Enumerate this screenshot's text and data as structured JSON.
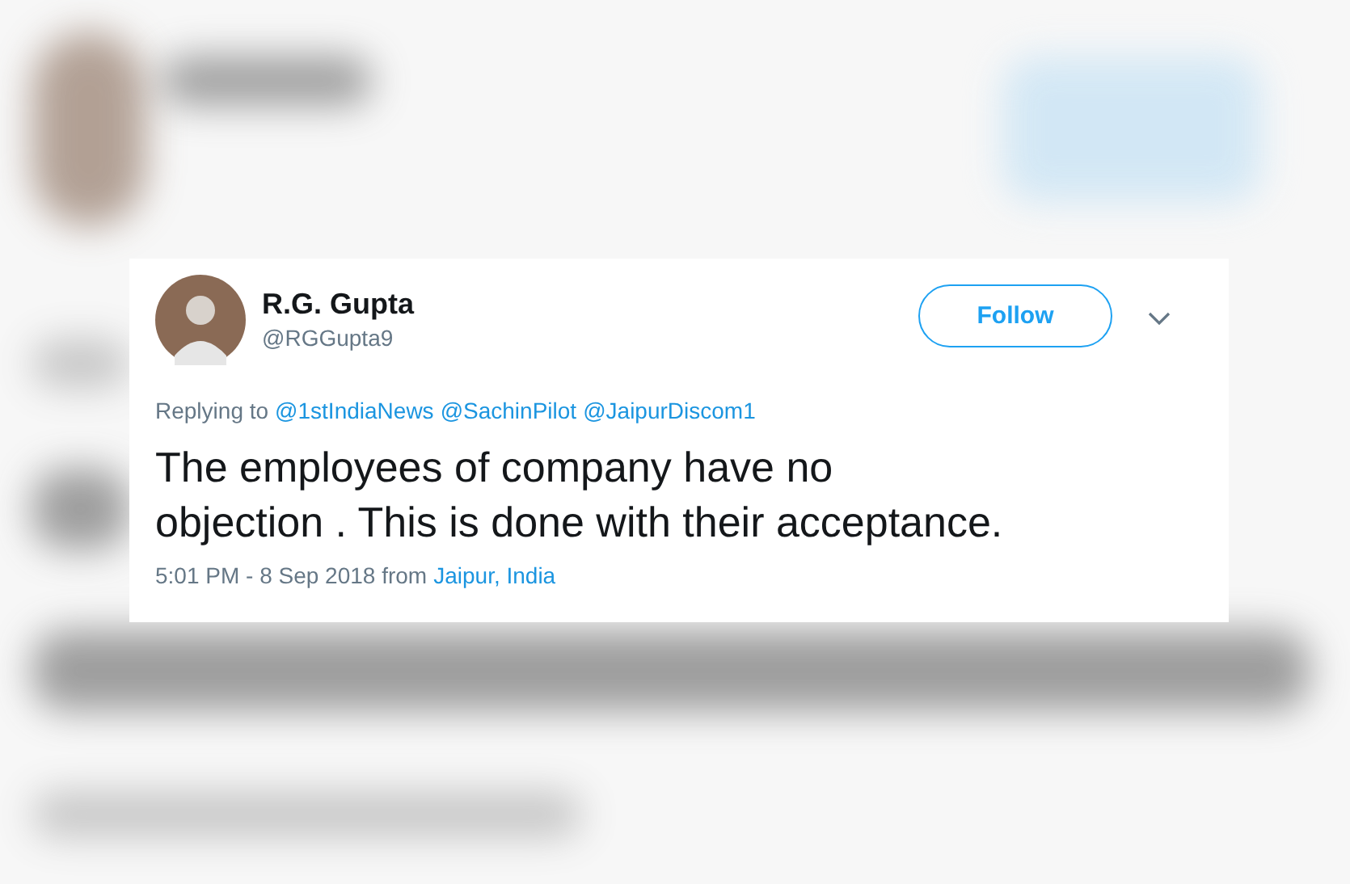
{
  "author": {
    "name": "R.G. Gupta",
    "handle": "@RGGupta9"
  },
  "follow_button": {
    "label": "Follow"
  },
  "reply_to": {
    "label": "Replying to",
    "mentions": [
      "@1stIndiaNews",
      "@SachinPilot",
      "@JaipurDiscom1"
    ]
  },
  "text_lines": [
    "The employees of company have no",
    "objection . This is done with their acceptance."
  ],
  "meta": {
    "timestamp": "5:01 PM - 8 Sep 2018 from",
    "location": "Jaipur, India"
  }
}
